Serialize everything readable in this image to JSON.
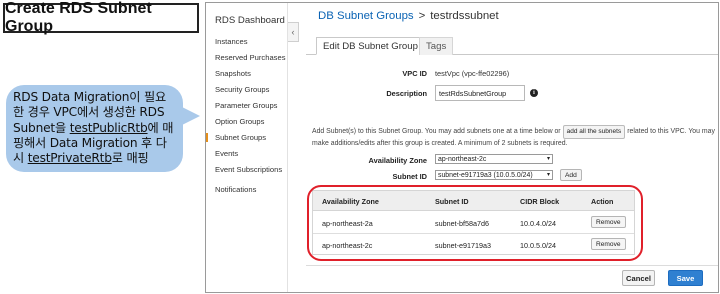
{
  "slide": {
    "title": "Create RDS Subnet Group",
    "callout": {
      "line1": "RDS Data Migration이 필요",
      "line2": "한 경우 VPC에서 생성한 RDS",
      "line3_a": "Subnet을 ",
      "line3_u": "testPublicRtb",
      "line3_b": "에 매",
      "line4": "핑해서 Data Migration 후 다",
      "line5_a": "시 ",
      "line5_u": "testPrivateRtb",
      "line5_b": "로 매핑"
    }
  },
  "sidebar": {
    "dashboard": "RDS Dashboard",
    "items": [
      "Instances",
      "Reserved Purchases",
      "Snapshots",
      "Security Groups",
      "Parameter Groups",
      "Option Groups",
      "Subnet Groups",
      "Events",
      "Event Subscriptions",
      "Notifications"
    ],
    "collapse_icon": "‹"
  },
  "breadcrumb": {
    "parent": "DB Subnet Groups",
    "separator": ">",
    "current": "testrdssubnet"
  },
  "tabs": {
    "edit": "Edit DB Subnet Group",
    "tags": "Tags"
  },
  "form": {
    "vpc_label": "VPC ID",
    "vpc_value": "testVpc (vpc-ffe02296)",
    "description_label": "Description",
    "description_value": "testRdsSubnetGroup",
    "help_a": "Add Subnet(s) to this Subnet Group. You may add subnets one at a time below or",
    "add_all_button": "add all the subnets",
    "help_b": "related to this VPC. You may make additions/edits after this group is created. A minimum of 2 subnets is required.",
    "az_label": "Availability Zone",
    "az_value": "ap-northeast-2c",
    "subnet_label": "Subnet ID",
    "subnet_value": "subnet-e91719a3 (10.0.5.0/24)",
    "add_button": "Add"
  },
  "table": {
    "headers": [
      "Availability Zone",
      "Subnet ID",
      "CIDR Block",
      "Action"
    ],
    "rows": [
      {
        "az": "ap-northeast-2a",
        "subnet": "subnet-bf58a7d6",
        "cidr": "10.0.4.0/24",
        "action": "Remove"
      },
      {
        "az": "ap-northeast-2c",
        "subnet": "subnet-e91719a3",
        "cidr": "10.0.5.0/24",
        "action": "Remove"
      }
    ]
  },
  "footer": {
    "cancel": "Cancel",
    "save": "Save"
  },
  "colors": {
    "accent": "#e48f1c",
    "link": "#0a63b4",
    "primary": "#2f80d1",
    "highlight": "#e0202a",
    "callout": "#a9c9ea"
  }
}
